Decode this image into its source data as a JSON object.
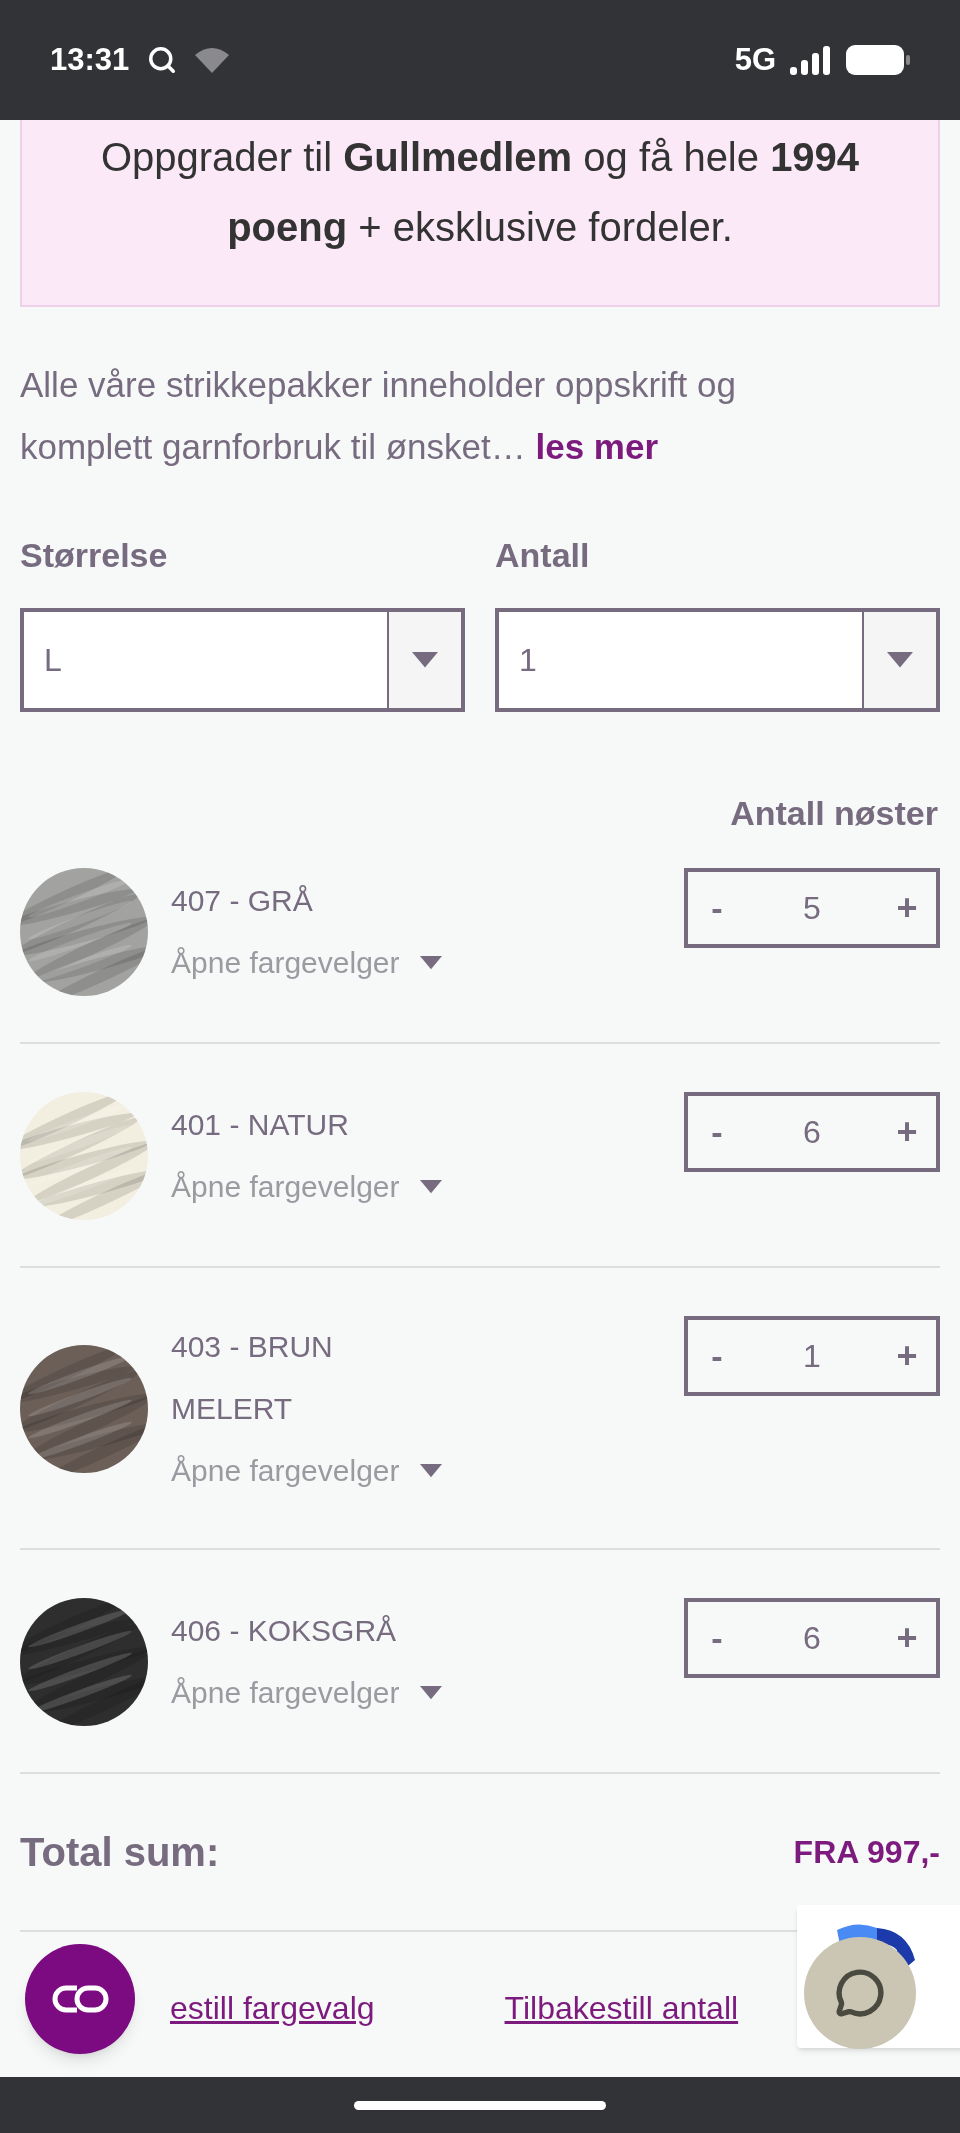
{
  "status_bar": {
    "time": "13:31",
    "network": "5G"
  },
  "banner": {
    "text": "Oppgrader til **Gullmedlem** og få hele **1994 poeng** + eksklusive fordeler."
  },
  "description": {
    "text": "Alle våre strikkepakker inneholder oppskrift og komplett garnforbruk til ønsket…",
    "link": "les mer"
  },
  "size_select": {
    "label": "Størrelse",
    "value": "L"
  },
  "quantity_select": {
    "label": "Antall",
    "value": "1"
  },
  "yarn_column_heading": "Antall nøster",
  "yarns": [
    {
      "name": "407 - GRÅ",
      "picker": "Åpne fargevelger",
      "decrement": "-",
      "count": "5",
      "increment": "+",
      "color": "#a2a3a0"
    },
    {
      "name": "401 - NATUR",
      "picker": "Åpne fargevelger",
      "decrement": "-",
      "count": "6",
      "increment": "+",
      "color": "#f3efe0"
    },
    {
      "name": "403 - BRUN MELERT",
      "picker": "Åpne fargevelger",
      "decrement": "-",
      "count": "1",
      "increment": "+",
      "color": "#6b5f58"
    },
    {
      "name": "406 - KOKSGRÅ",
      "picker": "Åpne fargevelger",
      "decrement": "-",
      "count": "6",
      "increment": "+",
      "color": "#2e2e2e"
    }
  ],
  "total": {
    "label": "Total sum:",
    "value": "FRA 997,-"
  },
  "links": [
    "estill fargevalg",
    "Tilbakestill antall"
  ]
}
